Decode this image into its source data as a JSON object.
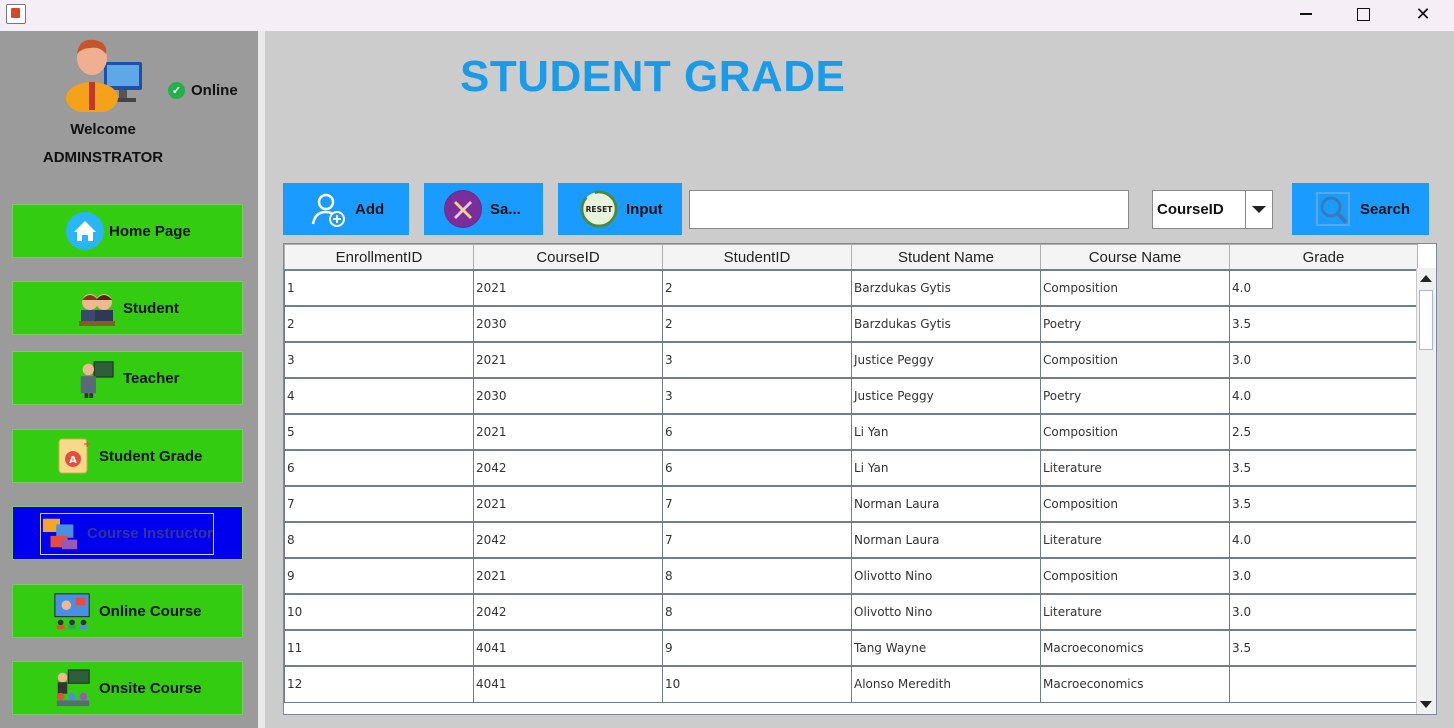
{
  "window": {
    "min_glyph": "",
    "max_glyph": "",
    "close_glyph": "✕"
  },
  "sidebar": {
    "status": "Online",
    "welcome": "Welcome",
    "role": "ADMINSTRATOR",
    "items": [
      {
        "label": "Home Page",
        "icon": "home-icon"
      },
      {
        "label": "Student",
        "icon": "students-icon"
      },
      {
        "label": "Teacher",
        "icon": "teacher-icon"
      },
      {
        "label": "Student Grade",
        "icon": "grade-certificate-icon"
      },
      {
        "label": "Course Instructor",
        "icon": "course-instructor-icon"
      },
      {
        "label": "Online Course",
        "icon": "online-course-icon"
      },
      {
        "label": "Onsite Course",
        "icon": "onsite-course-icon"
      }
    ],
    "active_item": "Course Instructor"
  },
  "main": {
    "title": "STUDENT GRADE",
    "toolbar": {
      "add_label": "Add",
      "save_label": "Sa...",
      "input_label": "Input",
      "reset_icon_text": "RESET",
      "search_value": "",
      "filter_value": "CourseID",
      "search_label": "Search"
    },
    "table": {
      "columns": [
        "EnrollmentID",
        "CourseID",
        "StudentID",
        "Student Name",
        "Course Name",
        "Grade"
      ],
      "rows": [
        [
          "1",
          "2021",
          "2",
          "Barzdukas Gytis",
          "Composition",
          "4.0"
        ],
        [
          "2",
          "2030",
          "2",
          "Barzdukas Gytis",
          "Poetry",
          "3.5"
        ],
        [
          "3",
          "2021",
          "3",
          "Justice Peggy",
          "Composition",
          "3.0"
        ],
        [
          "4",
          "2030",
          "3",
          "Justice Peggy",
          "Poetry",
          "4.0"
        ],
        [
          "5",
          "2021",
          "6",
          "Li Yan",
          "Composition",
          "2.5"
        ],
        [
          "6",
          "2042",
          "6",
          "Li Yan",
          "Literature",
          "3.5"
        ],
        [
          "7",
          "2021",
          "7",
          "Norman Laura",
          "Composition",
          "3.5"
        ],
        [
          "8",
          "2042",
          "7",
          "Norman Laura",
          "Literature",
          "4.0"
        ],
        [
          "9",
          "2021",
          "8",
          "Olivotto Nino",
          "Composition",
          "3.0"
        ],
        [
          "10",
          "2042",
          "8",
          "Olivotto Nino",
          "Literature",
          "3.0"
        ],
        [
          "11",
          "4041",
          "9",
          "Tang Wayne",
          "Macroeconomics",
          "3.5"
        ],
        [
          "12",
          "4041",
          "10",
          "Alonso Meredith",
          "Macroeconomics",
          ""
        ]
      ]
    }
  },
  "colors": {
    "nav_green": "#33cc11",
    "nav_active": "#0000ee",
    "toolbar_blue": "#1a9bff",
    "title_blue": "#1a9bea"
  }
}
